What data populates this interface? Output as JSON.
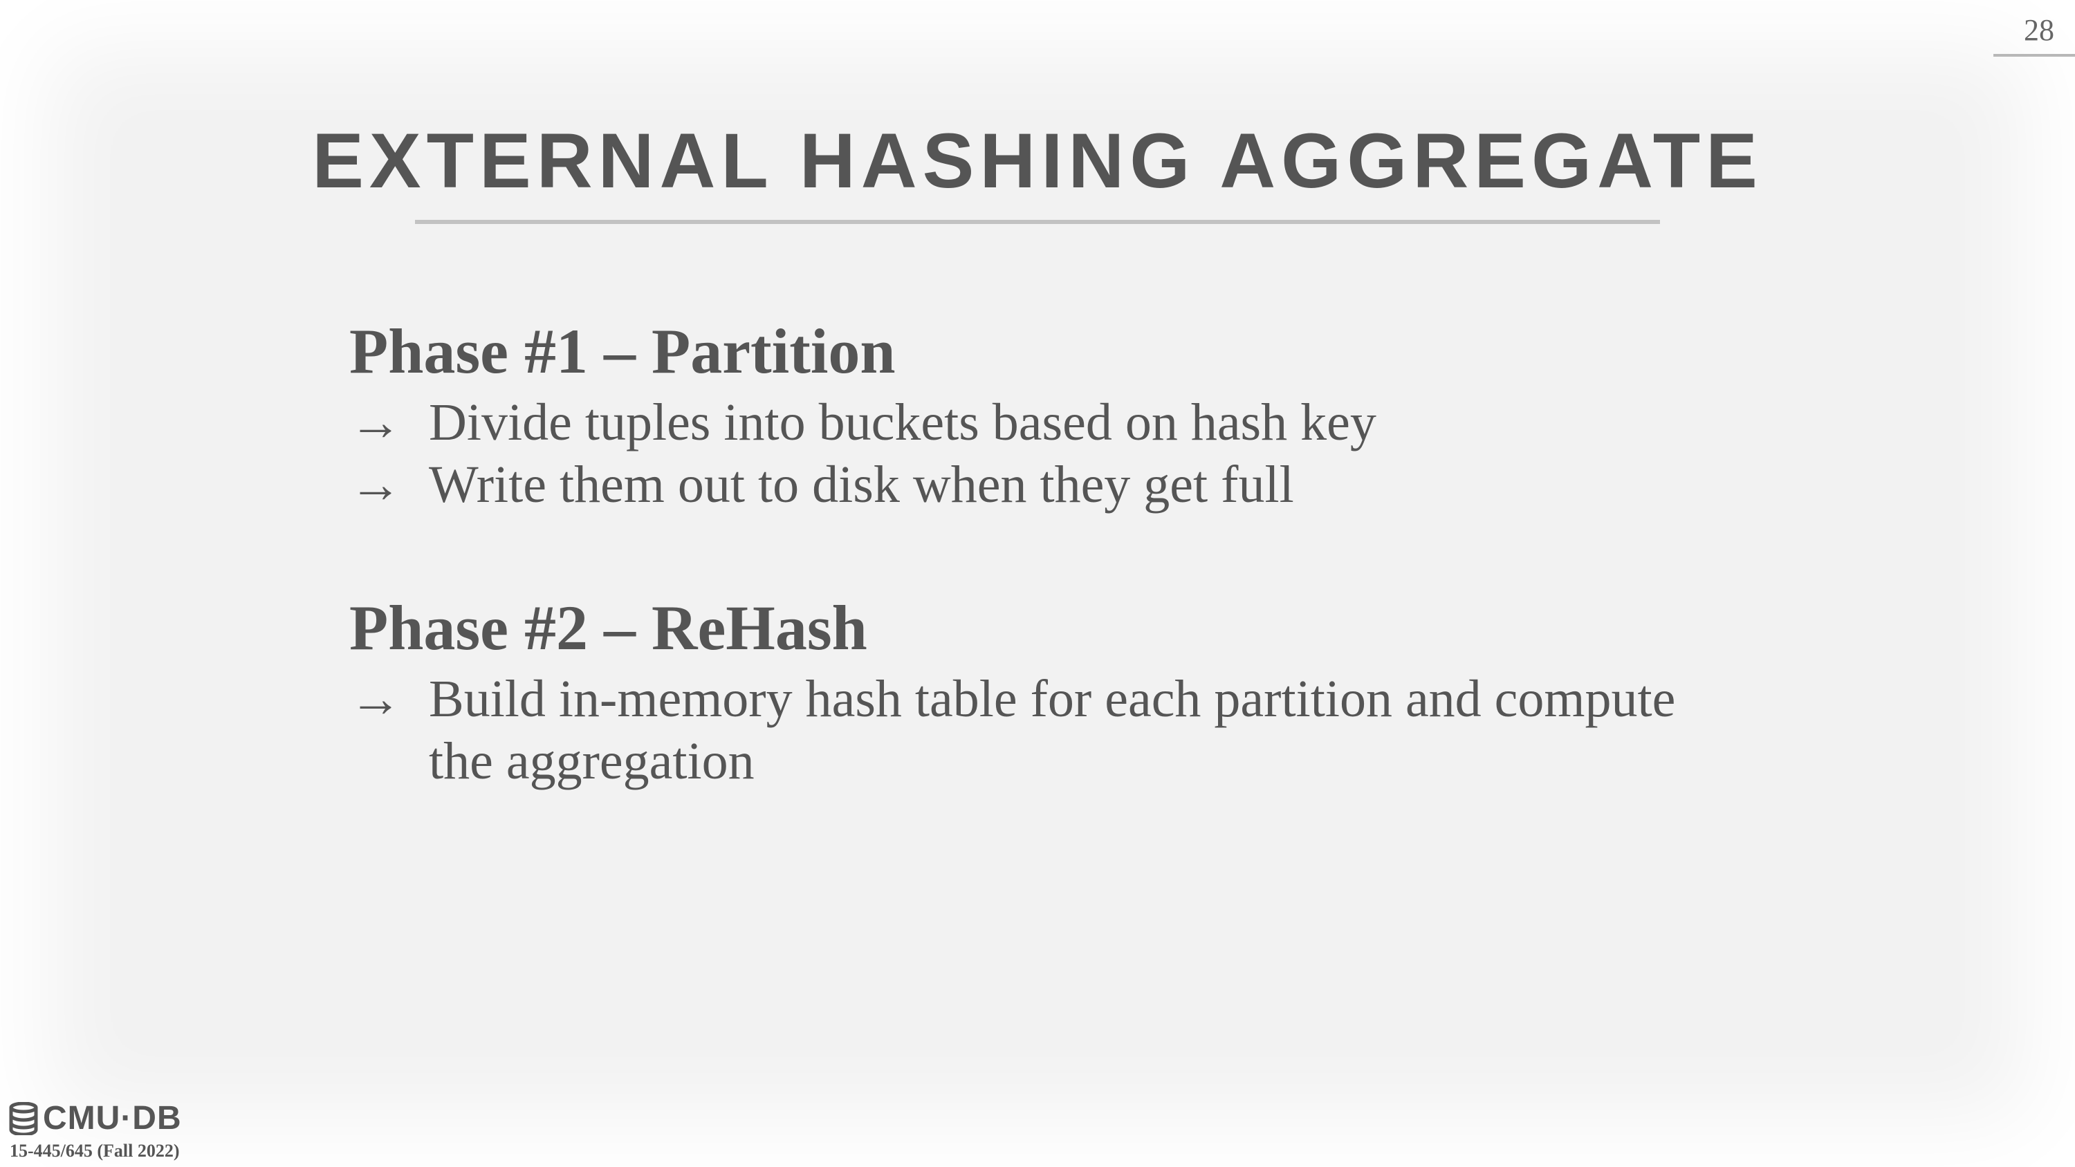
{
  "slide": {
    "page_number": "28",
    "title": "EXTERNAL HASHING AGGREGATE",
    "sections": [
      {
        "heading": "Phase #1 – Partition",
        "bullets": [
          "Divide tuples into buckets based on hash key",
          "Write them out to disk when they get full"
        ]
      },
      {
        "heading": "Phase #2 – ReHash",
        "bullets": [
          "Build in-memory hash table for each partition and compute the aggregation"
        ]
      }
    ],
    "bullet_marker": "→"
  },
  "footer": {
    "logo_icon": "database-stack-icon",
    "logo_text": "CMU·DB",
    "course": "15-445/645 (Fall 2022)"
  },
  "colors": {
    "background": "#f2f2f2",
    "text": "#555555",
    "rule": "#c2c2c2"
  }
}
